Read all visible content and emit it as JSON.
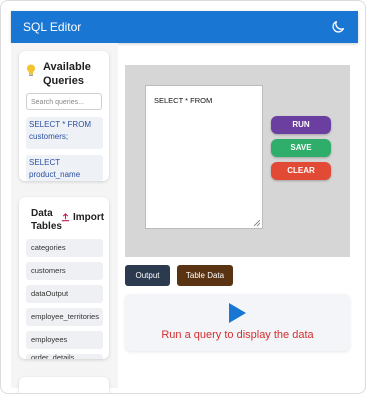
{
  "header": {
    "title": "SQL Editor",
    "theme_icon": "moon-icon"
  },
  "queries": {
    "title": "Available Queries",
    "search_placeholder": "Search queries...",
    "items": [
      {
        "label": "SELECT * FROM customers;"
      },
      {
        "label": "SELECT product_name"
      }
    ]
  },
  "tables": {
    "title": "Data Tables",
    "import_label": "Import",
    "items": [
      {
        "label": "categories"
      },
      {
        "label": "customers"
      },
      {
        "label": "dataOutput"
      },
      {
        "label": "employee_territories"
      },
      {
        "label": "employees"
      },
      {
        "label": "order_details"
      }
    ]
  },
  "editor": {
    "query_text": "SELECT * FROM"
  },
  "actions": {
    "run_label": "RUN",
    "save_label": "SAVE",
    "clear_label": "CLEAR"
  },
  "tabs": {
    "output_label": "Output",
    "table_data_label": "Table Data"
  },
  "result": {
    "message": "Run a query to display the data"
  },
  "colors": {
    "header": "#1976d2",
    "run": "#6b3fa0",
    "save": "#2fae6b",
    "clear": "#e24a36",
    "output_tab": "#2b3a4f",
    "table_data_tab": "#5a3412",
    "play": "#1976d2",
    "message": "#d32f2f"
  }
}
